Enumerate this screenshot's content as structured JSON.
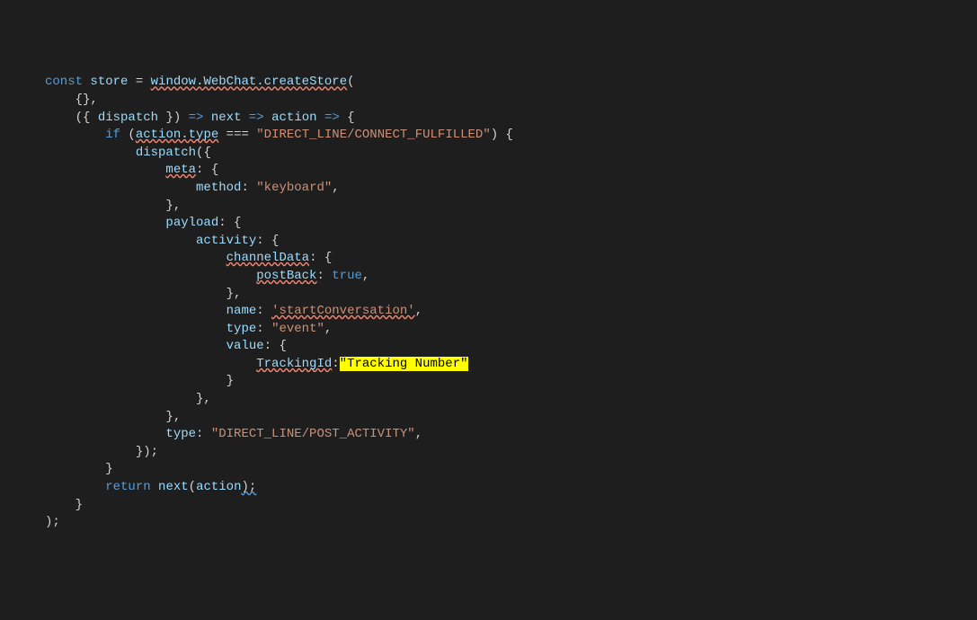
{
  "code": {
    "kw_const": "const",
    "store": "store",
    "eq": " = ",
    "window_webchat": "window.WebChat.createStore",
    "open_paren": "(",
    "empty_obj": "{},",
    "destructure_open": "({ ",
    "dispatch": "dispatch",
    "destructure_close": " }) ",
    "arrow": "=>",
    "next": "next",
    "action": "action",
    "open_brace": "{",
    "kw_if": "if",
    "action_type": "action.type",
    "triple_eq": " === ",
    "str_connect": "\"DIRECT_LINE/CONNECT_FULFILLED\"",
    "close_paren_brace": ") {",
    "dispatch_call": "dispatch",
    "open_obj": "({",
    "meta": "meta",
    "colon_brace": ": {",
    "method": "method",
    "colon": ": ",
    "str_keyboard": "\"keyboard\"",
    "comma": ",",
    "close_brace_comma": "},",
    "payload": "payload",
    "activity": "activity",
    "channelData": "channelData",
    "postBack": "postBack",
    "bool_true": "true",
    "name": "name",
    "str_start": "'startConversation'",
    "type_prop": "type",
    "str_event": "\"event\"",
    "value": "value",
    "trackingId": "TrackingId",
    "colon2": ":",
    "str_tracking": "\"Tracking Number\"",
    "close_brace": "}",
    "str_post": "\"DIRECT_LINE/POST_ACTIVITY\"",
    "close_obj": "});",
    "kw_return": "return",
    "next_call": "next",
    "action_arg": "action",
    "close_paren_semi": ");",
    "close_paren": ")"
  }
}
